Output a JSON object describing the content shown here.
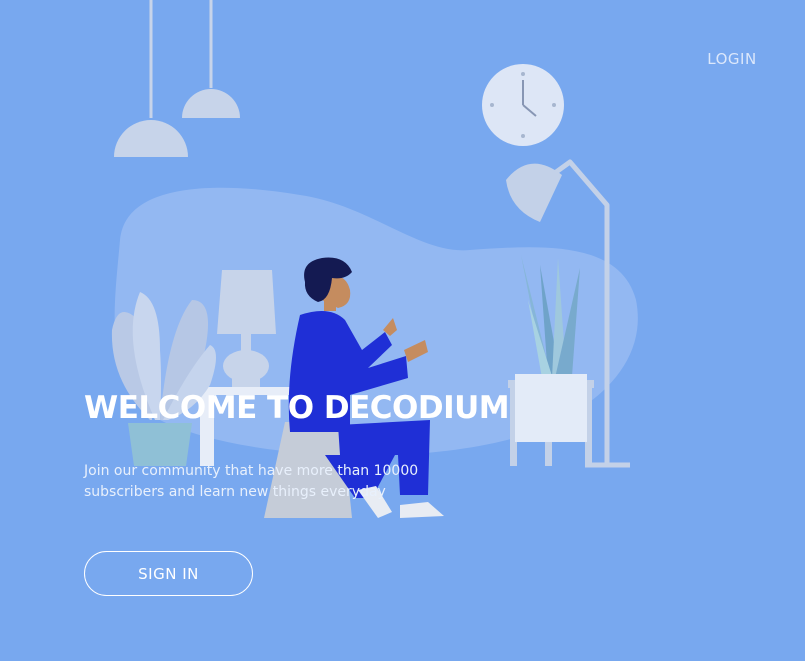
{
  "header": {
    "login_label": "LOGIN"
  },
  "hero": {
    "title": "WELCOME TO DECODIUM",
    "description": "Join our community that have more than 10000 subscribers and learn new things everyday",
    "signin_label": "SIGN IN"
  },
  "icons": [
    "pendant-lamp-icon",
    "wall-clock-icon",
    "floor-lamp-icon",
    "table-lamp-icon",
    "potted-plant-icon"
  ],
  "colors": {
    "background": "#78a8ef",
    "accent": "#1f2fd6",
    "text": "#ffffff"
  }
}
